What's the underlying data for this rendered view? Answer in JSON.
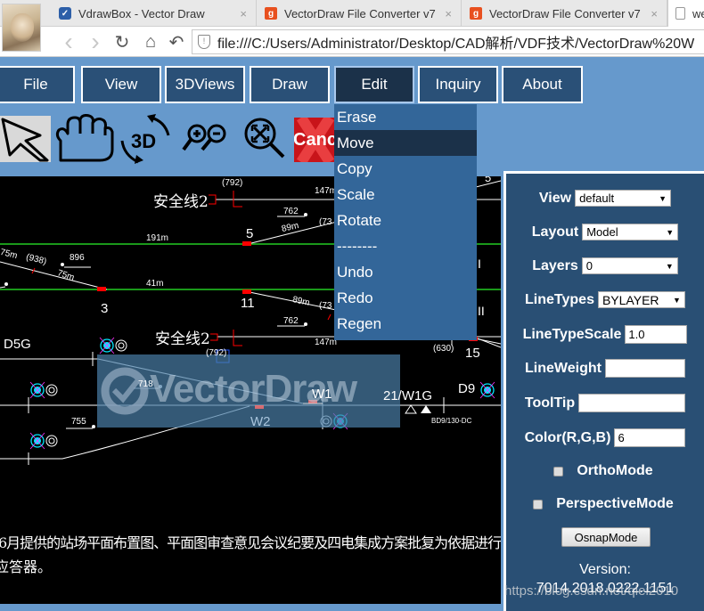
{
  "browser": {
    "tabs": [
      {
        "title": "VdrawBox - Vector Draw",
        "icon": "vectordraw-logo-icon",
        "close": "×"
      },
      {
        "title": "VectorDraw File Converter v7",
        "icon": "orange-g-icon",
        "close": "×"
      },
      {
        "title": "VectorDraw File Converter v7",
        "icon": "orange-g-icon",
        "close": "×"
      },
      {
        "title": "we",
        "icon": "page-icon"
      }
    ],
    "nav": {
      "back": "‹",
      "forward": "›",
      "reload": "↻",
      "home": "⌂",
      "undo": "↶"
    },
    "url": "file:///C:/Users/Administrator/Desktop/CAD解析/VDF技术/VectorDraw%20W"
  },
  "menu": {
    "items": [
      "File",
      "View",
      "3DViews",
      "Draw",
      "Edit",
      "Inquiry",
      "About"
    ],
    "active": "Edit"
  },
  "edit_dropdown": {
    "items": [
      "Erase",
      "Move",
      "Copy",
      "Scale",
      "Rotate",
      "--------",
      "Undo",
      "Redo",
      "Regen"
    ],
    "hovered": "Move"
  },
  "toolbar": {
    "tools": [
      "select-arrow-icon",
      "pan-hand-icon",
      "rotate-3d-icon",
      "zoom-in-out-icon",
      "zoom-extents-icon",
      "cancel-icon"
    ],
    "rotate_label": "3D",
    "cancel_label": "Canc"
  },
  "drawing": {
    "labels": {
      "safety_line_1": "安全线2",
      "safety_line_2": "安全线2",
      "dim_792a": "(792)",
      "dim_792b": "(792)",
      "len_147a": "147m",
      "len_147b": "147m",
      "num_762a": "762",
      "num_762b": "762",
      "len_89a": "89m",
      "len_89b": "89m",
      "dim_73a": "(73",
      "dim_73b": "(73",
      "node_5": "5",
      "node_3": "3",
      "node_11": "11",
      "node_15": "15",
      "len_191": "191m",
      "len_41": "41m",
      "len_75a": "75m",
      "len_75b": "75m",
      "dim_938": "(938)",
      "num_896": "896",
      "sig_d5g": "D5G",
      "sig_d9": "D9",
      "num_718": "718",
      "num_755": "755",
      "sw_w1": "W1",
      "sw_w2": "W2",
      "track_21w1g": "21/W1G",
      "dim_630": "(630)",
      "balise": "BD9/130-DC",
      "top_5": "5",
      "roman_i": "I",
      "roman_ii": "II",
      "note_line1": "6月提供的站场平面布置图、平面图审查意见会议纪要及四电集成方案批复为依据进行",
      "note_line2": "应答器。",
      "watermark_logo": "VectorDraw"
    },
    "colors": {
      "background": "#000000",
      "track": "#ffffff",
      "green_line": "#22cc22",
      "switch_mark": "#ff0000",
      "signal_fill": "#00e5ff",
      "signal_x": "#ff33ff"
    }
  },
  "properties": {
    "view": {
      "label": "View",
      "value": "default"
    },
    "layout": {
      "label": "Layout",
      "value": "Model"
    },
    "layers": {
      "label": "Layers",
      "value": "0"
    },
    "linetypes": {
      "label": "LineTypes",
      "value": "BYLAYER"
    },
    "linetypescale": {
      "label": "LineTypeScale",
      "value": "1.0"
    },
    "lineweight": {
      "label": "LineWeight",
      "value": ""
    },
    "tooltip": {
      "label": "ToolTip",
      "value": ""
    },
    "color": {
      "label": "Color(R,G,B)",
      "value": "6"
    },
    "orthomode": {
      "label": "OrthoMode",
      "checked": false
    },
    "perspectivemode": {
      "label": "PerspectiveMode",
      "checked": false
    },
    "osnap_button": "OsnapMode",
    "version_label": "Version:",
    "version_value": "7014.2018.0222.1151"
  },
  "overlay_watermark": "https://blog.csdn.net/qlei2010",
  "colors": {
    "page_bg": "#6699cc",
    "menu_bg": "#2a5077",
    "menu_active": "#1b3149",
    "dropdown_bg": "#336699",
    "panel_bg": "#294f74"
  }
}
